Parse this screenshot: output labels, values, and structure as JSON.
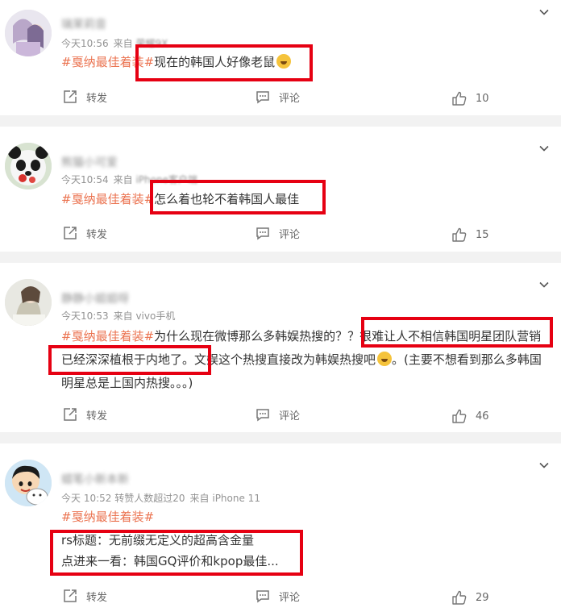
{
  "posts": [
    {
      "username": "璃茉莉音",
      "time": "今天10:56",
      "from_label": "来自",
      "source": "荣耀9X",
      "hashtag": "#戛纳最佳着装#",
      "text": "现在的韩国人好像老鼠",
      "repost": "转发",
      "comment": "评论",
      "likes": "10"
    },
    {
      "username": "熊猫小可爱",
      "time": "今天10:54",
      "from_label": "来自",
      "source": "iPhone客户端",
      "hashtag": "#戛纳最佳着装#",
      "text": "怎么着也轮不着韩国人最佳",
      "repost": "转发",
      "comment": "评论",
      "likes": "15"
    },
    {
      "username": "静静小姐姐呀",
      "time": "今天10:53",
      "from_label": "来自",
      "source": "vivo手机",
      "hashtag": "#戛纳最佳着装#",
      "text_a": "为什么现在微博那么多韩娱热搜的？？",
      "text_hl": "很难让人不相信韩国明星团队营销已经深深植根于内地了。",
      "text_b": "文娱这个热搜直接改为韩娱热搜吧",
      "text_c": "。(主要不想看到那么多韩国明星总是上国内热搜。。。)",
      "repost": "转发",
      "comment": "评论",
      "likes": "46"
    },
    {
      "username": "蜡笔小新本新",
      "time": "今天 10:52",
      "extra": "转赞人数超过20",
      "from_label": "来自",
      "source": "iPhone 11",
      "hashtag": "#戛纳最佳着装#",
      "line1": "rs标题：无前缀无定义的超高含金量",
      "line2": "点进来一看：韩国GQ评价和kpop最佳...",
      "repost": "转发",
      "comment": "评论",
      "likes": "29"
    }
  ],
  "colors": {
    "hashtag": "#eb7350",
    "highlight_box": "#e60012",
    "meta": "#939393"
  },
  "icons": [
    "repost-icon",
    "comment-icon",
    "like-icon",
    "chevron-down-icon"
  ]
}
